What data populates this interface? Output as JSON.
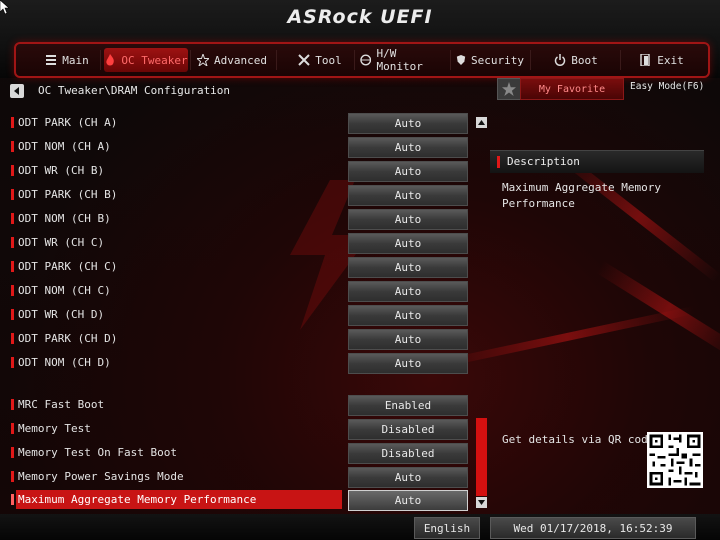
{
  "title": "ASRock UEFI",
  "tabs": [
    {
      "label": "Main",
      "icon": "list-icon"
    },
    {
      "label": "OC Tweaker",
      "icon": "flame-icon"
    },
    {
      "label": "Advanced",
      "icon": "star-icon"
    },
    {
      "label": "Tool",
      "icon": "tool-icon"
    },
    {
      "label": "H/W Monitor",
      "icon": "monitor-icon"
    },
    {
      "label": "Security",
      "icon": "shield-icon"
    },
    {
      "label": "Boot",
      "icon": "power-icon"
    },
    {
      "label": "Exit",
      "icon": "exit-icon"
    }
  ],
  "active_tab": "OC Tweaker",
  "breadcrumb": "OC Tweaker\\DRAM Configuration",
  "favorite_label": "My Favorite",
  "easy_mode_label": "Easy Mode(F6)",
  "settings": [
    {
      "label": "ODT PARK (CH A)",
      "value": "Auto"
    },
    {
      "label": "ODT NOM (CH A)",
      "value": "Auto"
    },
    {
      "label": "ODT WR (CH B)",
      "value": "Auto"
    },
    {
      "label": "ODT PARK (CH B)",
      "value": "Auto"
    },
    {
      "label": "ODT NOM (CH B)",
      "value": "Auto"
    },
    {
      "label": "ODT WR (CH C)",
      "value": "Auto"
    },
    {
      "label": "ODT PARK (CH C)",
      "value": "Auto"
    },
    {
      "label": "ODT NOM (CH C)",
      "value": "Auto"
    },
    {
      "label": "ODT WR (CH D)",
      "value": "Auto"
    },
    {
      "label": "ODT PARK (CH D)",
      "value": "Auto"
    },
    {
      "label": "ODT NOM (CH D)",
      "value": "Auto"
    },
    {
      "label": "MRC Fast Boot",
      "value": "Enabled"
    },
    {
      "label": "Memory Test",
      "value": "Disabled"
    },
    {
      "label": "Memory Test On Fast Boot",
      "value": "Disabled"
    },
    {
      "label": "Memory Power Savings Mode",
      "value": "Auto"
    },
    {
      "label": "Maximum Aggregate Memory Performance",
      "value": "Auto"
    }
  ],
  "selected_setting": "Maximum Aggregate Memory Performance",
  "description": {
    "heading": "Description",
    "text": "Maximum Aggregate Memory Performance"
  },
  "qr_text": "Get details via QR code",
  "footer": {
    "language": "English",
    "datetime": "Wed 01/17/2018, 16:52:39"
  },
  "colors": {
    "accent": "#c81414",
    "background": "#0b0708",
    "text": "#e4e4e4"
  }
}
